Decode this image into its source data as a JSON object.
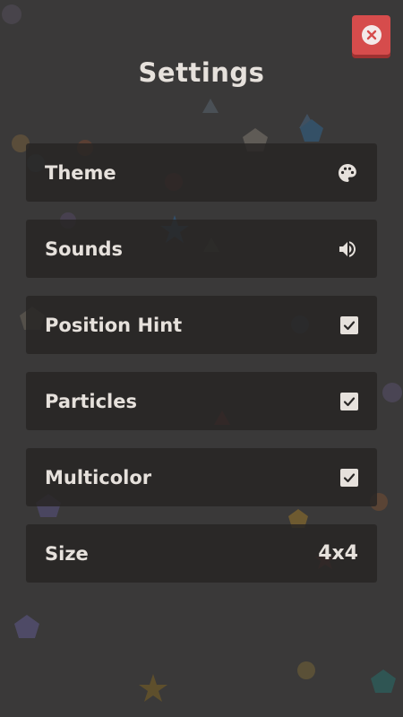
{
  "header": {
    "title": "Settings",
    "close_icon": "close-icon"
  },
  "settings": [
    {
      "label": "Theme",
      "control": "palette-icon"
    },
    {
      "label": "Sounds",
      "control": "speaker-icon"
    },
    {
      "label": "Position Hint",
      "control": "checkbox",
      "checked": true
    },
    {
      "label": "Particles",
      "control": "checkbox",
      "checked": true
    },
    {
      "label": "Multicolor",
      "control": "checkbox",
      "checked": true
    },
    {
      "label": "Size",
      "control": "value",
      "value": "4x4"
    }
  ],
  "colors": {
    "background": "#3a3939",
    "row": "#282625",
    "text": "#e6e1dc",
    "close_button": "#d64c4c"
  }
}
